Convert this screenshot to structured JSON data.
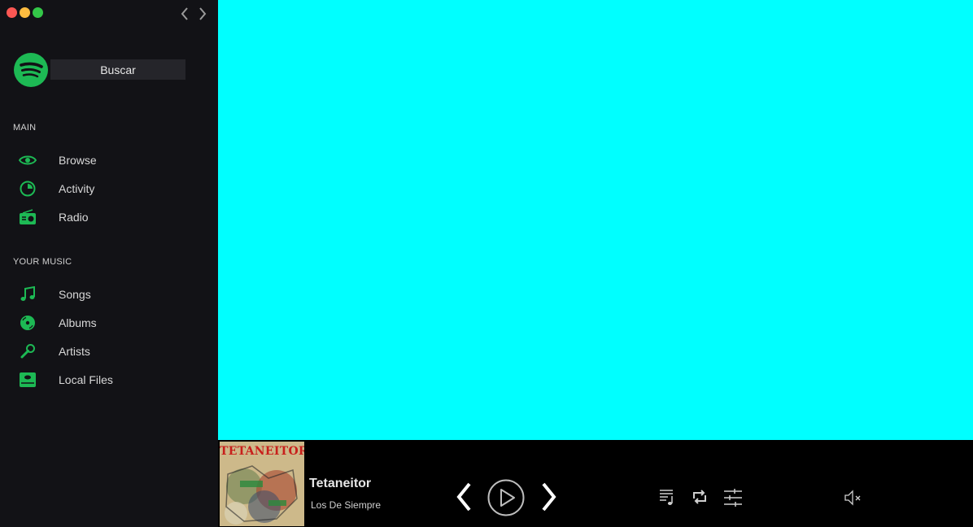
{
  "search": {
    "value": "Buscar"
  },
  "sections": {
    "main": "MAIN",
    "your_music": "YOUR MUSIC"
  },
  "nav": {
    "main": [
      {
        "label": "Browse",
        "icon": "eye-icon"
      },
      {
        "label": "Activity",
        "icon": "activity-pie-icon"
      },
      {
        "label": "Radio",
        "icon": "radio-icon"
      }
    ],
    "your_music": [
      {
        "label": "Songs",
        "icon": "music-note-icon"
      },
      {
        "label": "Albums",
        "icon": "vinyl-disc-icon"
      },
      {
        "label": "Artists",
        "icon": "microphone-icon"
      },
      {
        "label": "Local Files",
        "icon": "local-drive-icon"
      }
    ]
  },
  "player": {
    "cover_text": "TETANEITOR",
    "title": "Tetaneitor",
    "artist": "Los De Siempre"
  },
  "colors": {
    "accent": "#1db954",
    "sidebar_bg": "#121216",
    "main_bg": "#00ffff",
    "player_bg": "#000000"
  }
}
